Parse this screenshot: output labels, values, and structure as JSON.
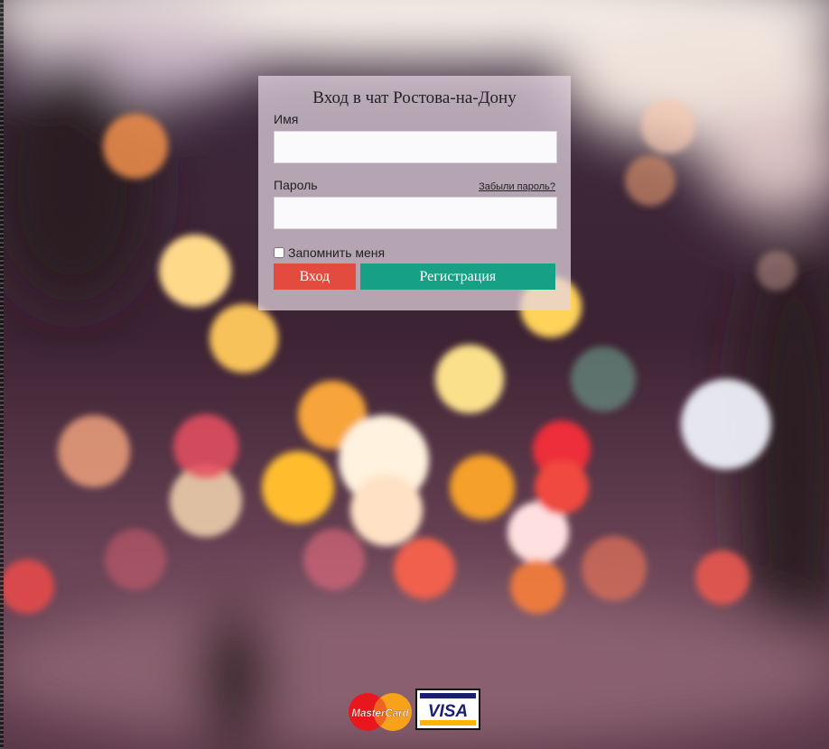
{
  "login": {
    "title": "Вход в чат Ростова-на-Дону",
    "name_label": "Имя",
    "name_value": "",
    "password_label": "Пароль",
    "password_value": "",
    "forgot_password": "Забыли пароль?",
    "remember_label": "Запомнить меня",
    "remember_checked": false,
    "login_button": "Вход",
    "register_button": "Регистрация"
  },
  "payment": {
    "mastercard_text": "MasterCard",
    "visa_text": "VISA"
  },
  "colors": {
    "login_button": "#e24b3d",
    "register_button": "#16a085",
    "panel_background": "#e4d6e2"
  }
}
